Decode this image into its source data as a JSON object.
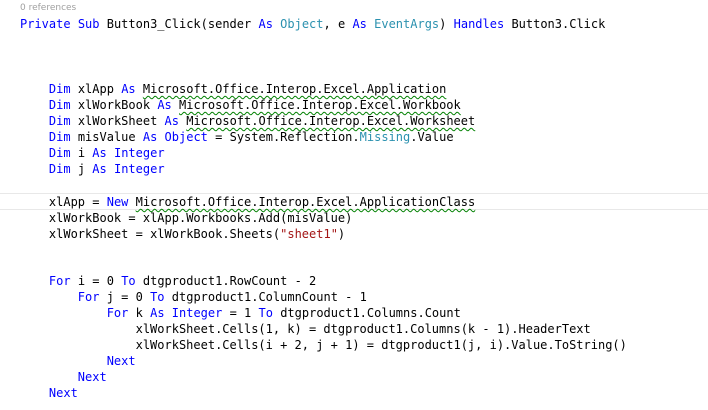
{
  "codelens": {
    "references": "0 references"
  },
  "tokens": {
    "private": "Private",
    "sub": "Sub",
    "button3_click": "Button3_Click(sender",
    "as": "As",
    "object": "Object",
    "comma_e": ", e",
    "eventargs": "EventArgs",
    "close_paren": ")",
    "handles": "Handles",
    "button3_click_ref": "Button3.Click",
    "dim": "Dim",
    "xlapp": "xlApp",
    "xlworkbook": "xlWorkBook",
    "xlworksheet": "xlWorkSheet",
    "misvalue": "misValue",
    "i": "i",
    "j": "j",
    "k": "k",
    "integer": "Integer",
    "excel_application": "Microsoft.Office.Interop.Excel.Application",
    "excel_workbook": "Microsoft.Office.Interop.Excel.Workbook",
    "excel_worksheet": "Microsoft.Office.Interop.Excel.Worksheet",
    "eq_system_reflection": "= System.Reflection.",
    "missing": "Missing",
    "dot_value": ".Value",
    "eq": "=",
    "new": "New",
    "excel_applicationclass": "Microsoft.Office.Interop.Excel.ApplicationClass",
    "workbooks_add": "= xlApp.Workbooks.Add(misValue)",
    "sheets_open": "= xlWorkBook.Sheets(",
    "sheet1_str": "\"sheet1\"",
    "for": "For",
    "to": "To",
    "i_assign_0": "i = 0",
    "j_assign_0": "j = 0",
    "k_assign": "k",
    "eq_1": "= 1",
    "rowcount_expr": "dtgproduct1.RowCount - 2",
    "columncount_expr": "dtgproduct1.ColumnCount - 1",
    "columns_count_expr": "dtgproduct1.Columns.Count",
    "header_line": "xlWorkSheet.Cells(1, k) = dtgproduct1.Columns(k - 1).HeaderText",
    "value_line": "xlWorkSheet.Cells(i + 2, j + 1) = dtgproduct1(j, i).Value.ToString()",
    "next": "Next"
  }
}
